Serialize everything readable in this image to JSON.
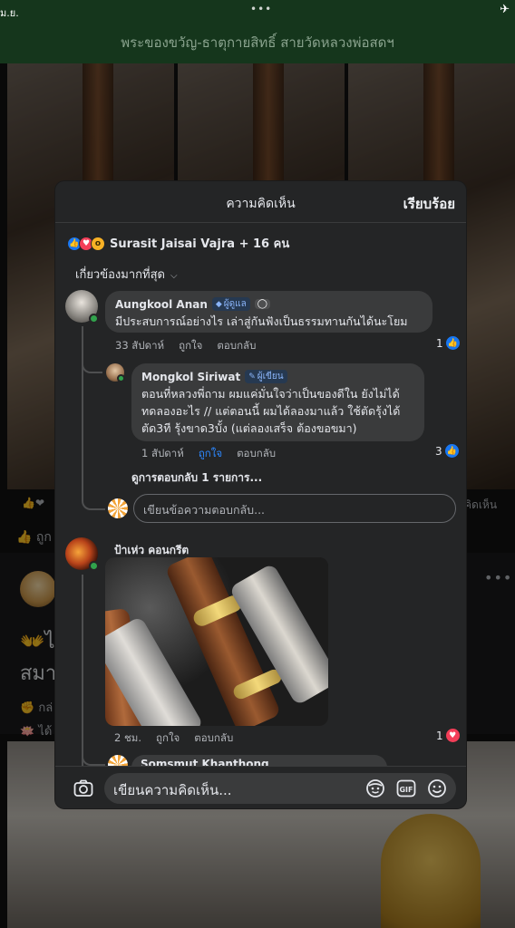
{
  "statusbar": {
    "clock": "ม.ย.",
    "dots": "•••",
    "plane": "✈"
  },
  "group": {
    "title": "พระของขวัญ-ธาตุกายสิทธิ์ สายวัดหลวงพ่อสดฯ"
  },
  "background_post": {
    "comments_partial": "คิดเห็น",
    "like_partial": "ถูก",
    "text_line1": "👐ไ",
    "text_line2": "สมา",
    "text_line3": "✊ กล่",
    "text_line4": "🪷 ได้",
    "more": "•••"
  },
  "sheet": {
    "title": "ความคิดเห็น",
    "done_label": "เรียบร้อย",
    "reactions": {
      "icons": [
        "like-icon",
        "love-icon",
        "wow-icon"
      ],
      "summary": "Surasit Jaisai Vajra + 16 คน"
    },
    "sort_label": "เกี่ยวข้องมากที่สุด",
    "comments": [
      {
        "author": "Aungkool Anan",
        "badge": "ผู้ดูแล",
        "text": "มีประสบการณ์อย่างไร เล่าสู่กันฟังเป็นธรรมทานกันได้นะโยม",
        "time": "33 สัปดาห์",
        "like_label": "ถูกใจ",
        "reply_label": "ตอบกลับ",
        "reaction_count": "1",
        "reply": {
          "author": "Mongkol Siriwat",
          "badge": "ผู้เขียน",
          "text_lines": [
            "ตอนที่หลวงพี่ถาม ผมแค่มั่นใจว่าเป็นของดีใน ยังไม่ได้",
            "ทดลองอะไร // แต่ตอนนี้ ผมได้ลองมาแล้ว ใช้ตัดรุ้งได้",
            "ตัด3ที รุ้งขาด3บั้ง (แต่ลองเสร็จ ต้องขอขมา)"
          ],
          "time": "1 สัปดาห์",
          "like_label": "ถูกใจ",
          "reply_label": "ตอบกลับ",
          "reaction_count": "3"
        },
        "view_replies": "ดูการตอบกลับ 1 รายการ...",
        "reply_placeholder": "เขียนข้อความตอบกลับ..."
      },
      {
        "author": "ป้าเห่ว คอนกรีต",
        "time": "2 ชม.",
        "like_label": "ถูกใจ",
        "reply_label": "ตอบกลับ",
        "reaction_count": "1",
        "next_author_partial": "Somsmut Khanthong"
      }
    ],
    "composer": {
      "placeholder": "เขียนความคิดเห็น...",
      "icons": [
        "camera-icon",
        "avatar-sticker-icon",
        "gif-icon",
        "emoji-icon"
      ]
    }
  },
  "colors": {
    "header_green": "#15361c",
    "sheet_bg": "#242526",
    "bubble_bg": "#3a3b3c",
    "like_blue": "#1877f2",
    "love_red": "#f33e58",
    "online_green": "#31a24c"
  }
}
